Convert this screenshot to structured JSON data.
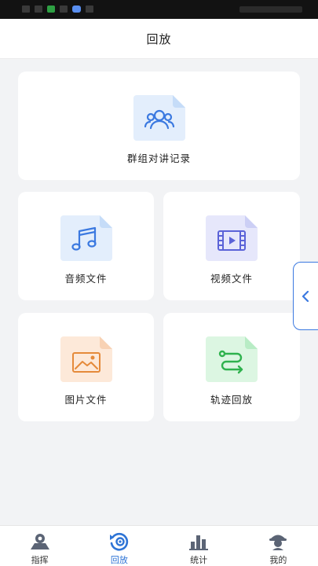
{
  "header": {
    "title": "回放"
  },
  "cards": {
    "group": {
      "label": "群组对讲记录",
      "icon": "group-users-icon",
      "color": "#3b79e0",
      "bg": "#e3eefc"
    },
    "audio": {
      "label": "音频文件",
      "icon": "music-note-icon",
      "color": "#3b79e0",
      "bg": "#e3eefc"
    },
    "video": {
      "label": "视频文件",
      "icon": "film-icon",
      "color": "#5b63d8",
      "bg": "#e6e7fb"
    },
    "image": {
      "label": "图片文件",
      "icon": "image-icon",
      "color": "#e58a3a",
      "bg": "#fde9d9"
    },
    "track": {
      "label": "轨迹回放",
      "icon": "route-icon",
      "color": "#2fb24e",
      "bg": "#dcf6e2"
    }
  },
  "side_tab": {
    "icon": "chevron-left-icon"
  },
  "tabbar": {
    "tabs": [
      {
        "label": "指挥",
        "icon": "command-person-icon",
        "active": false
      },
      {
        "label": "回放",
        "icon": "replay-icon",
        "active": true
      },
      {
        "label": "统计",
        "icon": "bar-chart-icon",
        "active": false
      },
      {
        "label": "我的",
        "icon": "profile-icon",
        "active": false
      }
    ],
    "active_color": "#2e74d6",
    "inactive_color": "#5b6475"
  }
}
